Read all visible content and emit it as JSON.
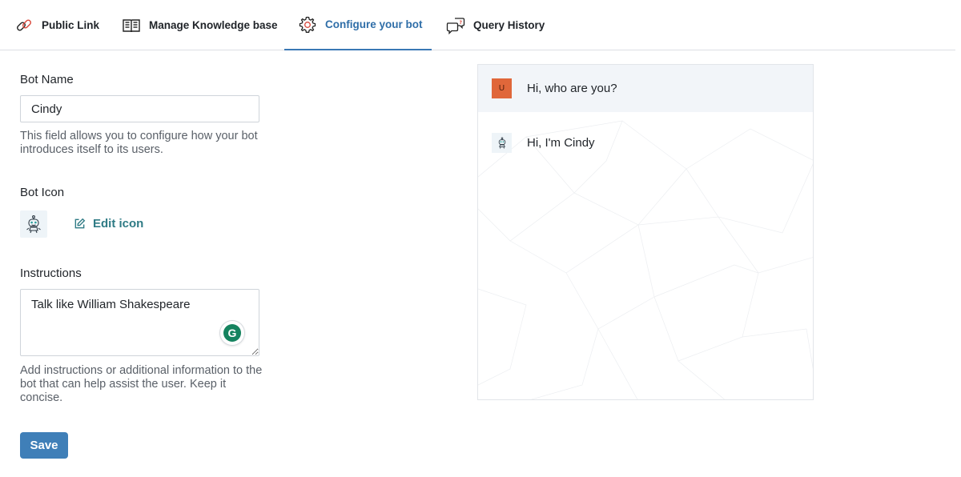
{
  "tabs": [
    {
      "label": "Public Link",
      "icon": "link-icon",
      "active": false
    },
    {
      "label": "Manage Knowledge base",
      "icon": "book-icon",
      "active": false
    },
    {
      "label": "Configure your bot",
      "icon": "gear-icon",
      "active": true
    },
    {
      "label": "Query History",
      "icon": "chat-bubbles-icon",
      "active": false
    }
  ],
  "form": {
    "bot_name": {
      "label": "Bot Name",
      "value": "Cindy",
      "help": "This field allows you to configure how your bot introduces itself to its users."
    },
    "bot_icon": {
      "label": "Bot Icon",
      "edit_label": "Edit icon",
      "icon": "robot-icon"
    },
    "instructions": {
      "label": "Instructions",
      "value": "Talk like William Shakespeare",
      "help": "Add instructions or additional information to the bot that can help assist the user. Keep it concise."
    },
    "save_label": "Save"
  },
  "preview": {
    "messages": [
      {
        "role": "user",
        "avatar_letter": "U",
        "text": "Hi, who are you?"
      },
      {
        "role": "bot",
        "text": "Hi, I'm Cindy"
      }
    ]
  },
  "colors": {
    "accent": "#3f7fb8",
    "active_tab": "#2f6ea8",
    "link": "#2f7b85",
    "user_avatar": "#e0673a",
    "grammarly": "#15835f"
  }
}
